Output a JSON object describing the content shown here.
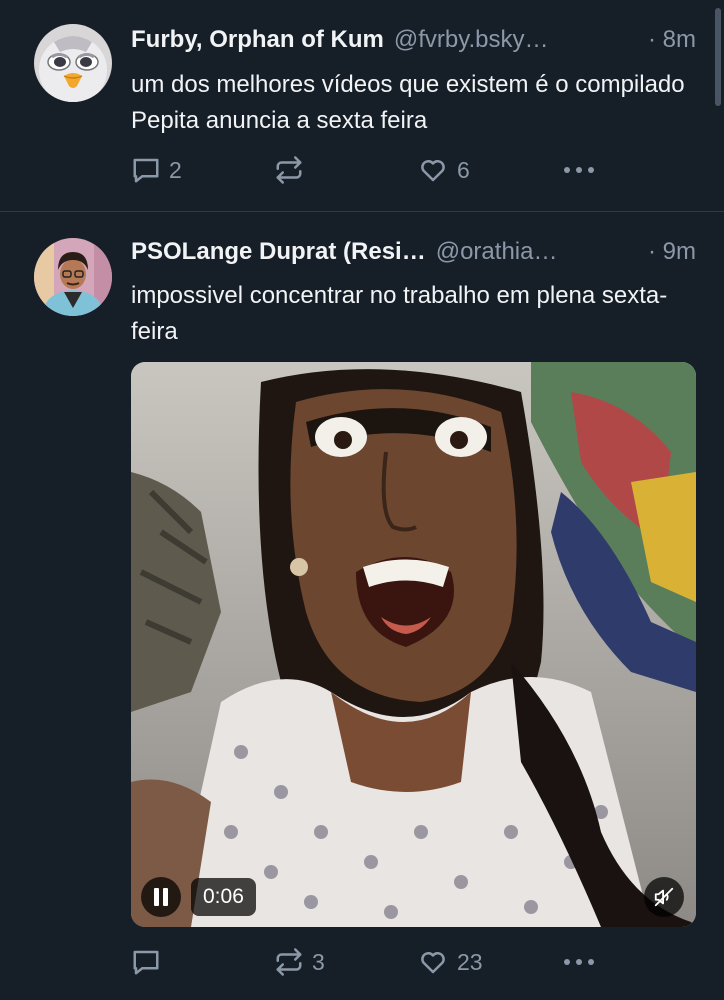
{
  "posts": [
    {
      "author_name": "Furby, Orphan of Kum",
      "handle": "@fvrby.bsky…",
      "time": "· 8m",
      "text": "um dos melhores vídeos que existem é o compilado Pepita anuncia a sexta feira",
      "replies": "2",
      "reposts": "",
      "likes": "6",
      "avatar_icon": "furby-avatar"
    },
    {
      "author_name": "PSOLange Duprat (Resi…",
      "handle": "@orathia…",
      "time": "· 9m",
      "text": "impossivel concentrar no trabalho em plena sexta-feira",
      "replies": "",
      "reposts": "3",
      "likes": "23",
      "avatar_icon": "person-avatar",
      "video": {
        "timecode": "0:06",
        "state": "playing",
        "muted": true
      }
    }
  ],
  "icons": {
    "reply": "speech-bubble-icon",
    "repost": "repost-arrows-icon",
    "like": "heart-icon",
    "more": "ellipsis-icon",
    "pause": "pause-icon",
    "mute": "speaker-muted-icon"
  },
  "colors": {
    "background": "#161e27",
    "text": "#f1f3f5",
    "muted_text": "#8b98a8",
    "divider": "#2e3a48"
  }
}
